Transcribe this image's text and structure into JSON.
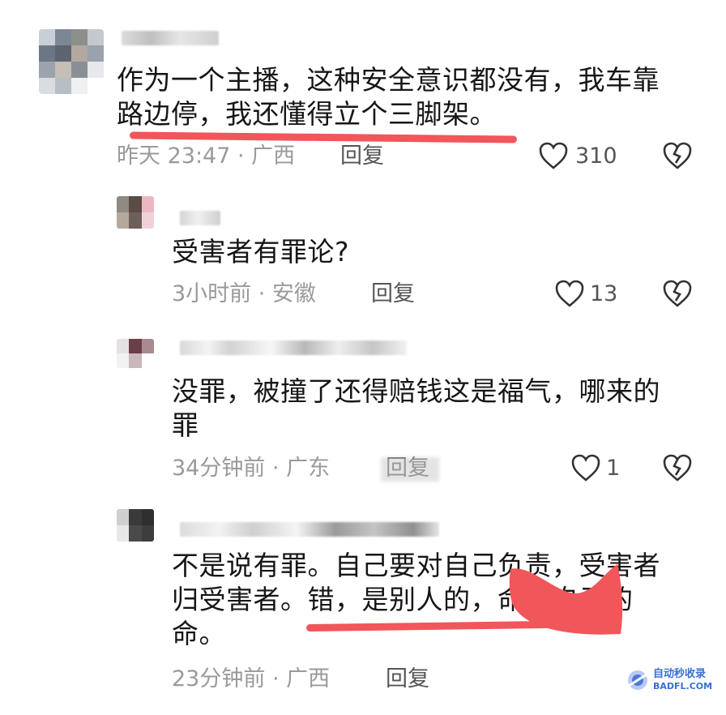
{
  "colors": {
    "highlight": "#f0565a",
    "meta_text": "#9a9a9a",
    "watermark_blue": "#3a6fd0"
  },
  "comments": [
    {
      "text": "作为一个主播，这种安全意识都没有，我车靠路边停，我还懂得立个三脚架。",
      "time": "昨天 23:47 · 广西",
      "reply": "回复",
      "likes": "310"
    },
    {
      "text": "受害者有罪论?",
      "time": "3小时前 · 安徽",
      "reply": "回复",
      "likes": "13"
    },
    {
      "text": "没罪，被撞了还得赔钱这是福气，哪来的罪",
      "time": "34分钟前 · 广东",
      "reply": "回复",
      "likes": "1"
    },
    {
      "text": "不是说有罪。自己要对自己负责，受害者归受害者。错，是别人的，命是自己的命。",
      "time": "23分钟前 · 广西",
      "reply": "回复"
    }
  ],
  "watermark": {
    "line1": "自动秒收录",
    "line2": "BADFL.COM"
  }
}
